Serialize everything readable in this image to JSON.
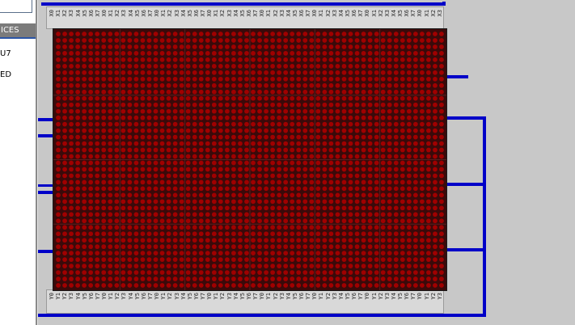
{
  "left_panel": {
    "header": "ICES",
    "items": [
      "U7",
      "ED"
    ]
  },
  "matrix": {
    "cols": 60,
    "rows": 40,
    "block_cols": 6,
    "block_rows": 4,
    "dot_color": "#a00000",
    "bg_color": "#3a0a0a",
    "grid_color": "#5a2020"
  },
  "top_pins": [
    "X0",
    "X1",
    "X2",
    "X3",
    "X4",
    "X5",
    "X6",
    "X7",
    "X0",
    "X1",
    "X2",
    "X3",
    "X4",
    "X5",
    "X6",
    "X7",
    "X0",
    "X1",
    "X2",
    "X3",
    "X4",
    "X5",
    "X6",
    "X7",
    "X0",
    "X1",
    "X2",
    "X3",
    "X4",
    "X5",
    "X6",
    "X7",
    "X0",
    "X1",
    "X2",
    "X3",
    "X4",
    "X5",
    "X6",
    "X7",
    "X0",
    "X1",
    "X2",
    "X3",
    "X4",
    "X5",
    "X6",
    "X7",
    "X0",
    "X1",
    "X2",
    "X3",
    "X4",
    "X5",
    "X6",
    "X7",
    "X0",
    "X1",
    "X2",
    "X3"
  ],
  "bottom_pins": [
    "Y0",
    "Y1",
    "Y2",
    "Y3",
    "Y4",
    "Y5",
    "Y6",
    "Y7",
    "Y0",
    "Y1",
    "Y2",
    "Y3",
    "Y4",
    "Y5",
    "Y6",
    "Y7",
    "Y0",
    "Y1",
    "Y2",
    "Y3",
    "Y4",
    "Y5",
    "Y6",
    "Y7",
    "Y0",
    "Y1",
    "Y2",
    "Y3",
    "Y4",
    "Y5",
    "Y6",
    "Y7",
    "Y0",
    "Y1",
    "Y2",
    "Y3",
    "Y4",
    "Y5",
    "Y6",
    "Y7",
    "Y0",
    "Y1",
    "Y2",
    "Y3",
    "Y4",
    "Y5",
    "Y6",
    "Y7",
    "Y0",
    "Y1",
    "Y2",
    "Y3",
    "Y4",
    "Y5",
    "Y6",
    "Y7",
    "Y0",
    "Y1",
    "Y2",
    "Y3"
  ],
  "colors": {
    "wire": "#0000c8",
    "canvas": "#c8c8c8"
  }
}
